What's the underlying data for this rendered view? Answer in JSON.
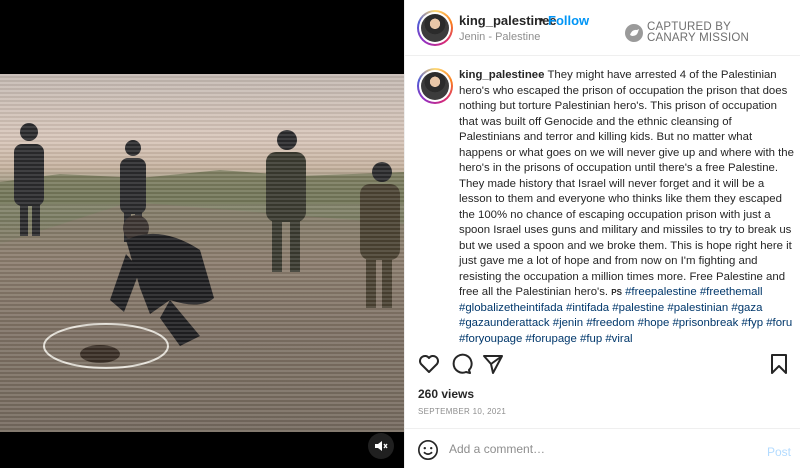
{
  "media": {
    "type": "video",
    "mute_icon": "speaker-muted-icon"
  },
  "header": {
    "username": "king_palestinee",
    "separator": "•",
    "follow_label": "Follow",
    "location": "Jenin - Palestine",
    "watermark_line1": "CAPTURED BY",
    "watermark_line2": "CANARY MISSION"
  },
  "caption": {
    "username": "king_palestinee",
    "text": "They might have arrested 4 of the Palestinian hero's who escaped the prison of occupation the prison that does nothing but torture Palestinian hero's. This prison of occupation that was built off Genocide and the ethnic cleansing of Palestinians and terror and killing kids. But no matter what happens or what goes on we will never give up and where with the hero's in the prisons of occupation until there's a free Palestine. They made history that Israel will never forget and it will be a lesson to them and everyone who thinks like them they escaped the 100% no chance of escaping occupation prison with just a spoon Israel uses guns and military and missiles to try to break us but we used a spoon and we broke them. This is hope right here it just gave me a lot of hope and from now on I'm fighting and resisting the occupation a million times more. Free Palestine and free all the Palestinian hero's.",
    "flag_code": "PS",
    "hashtags": [
      "#freepalestine",
      "#freethemall",
      "#globalizetheintifada",
      "#intifada",
      "#palestine",
      "#palestinian",
      "#gaza",
      "#gazaunderattack",
      "#jenin",
      "#freedom",
      "#hope",
      "#prisonbreak",
      "#fyp",
      "#foru",
      "#foryoupage",
      "#forupage",
      "#fup",
      "#viral"
    ]
  },
  "actions": {
    "like_icon": "heart-icon",
    "comment_icon": "comment-icon",
    "share_icon": "paper-plane-icon",
    "save_icon": "bookmark-icon"
  },
  "stats": {
    "views": "260 views",
    "date": "SEPTEMBER 10, 2021"
  },
  "comment": {
    "emoji_icon": "smiley-icon",
    "placeholder": "Add a comment…",
    "post_label": "Post"
  },
  "colors": {
    "accent": "#0095f6",
    "hashtag": "#00376b",
    "muted": "#8e8e8e",
    "post_disabled": "#b3dbff"
  }
}
